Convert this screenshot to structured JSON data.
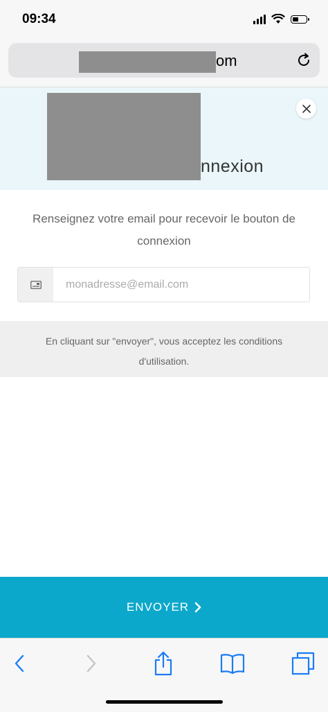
{
  "status_bar": {
    "time": "09:34"
  },
  "browser": {
    "url_visible": "om"
  },
  "header": {
    "title_visible": "nnexion"
  },
  "instruction": "Renseignez votre email pour recevoir le bouton de connexion",
  "email": {
    "placeholder": "monadresse@email.com",
    "value": ""
  },
  "terms": "En cliquant sur \"envoyer\", vous acceptez les conditions d'utilisation.",
  "submit": {
    "label": "ENVOYER"
  },
  "colors": {
    "accent": "#0ba8cb",
    "header_bg": "#eaf6f9",
    "toolbar_blue": "#1a7cf5"
  }
}
